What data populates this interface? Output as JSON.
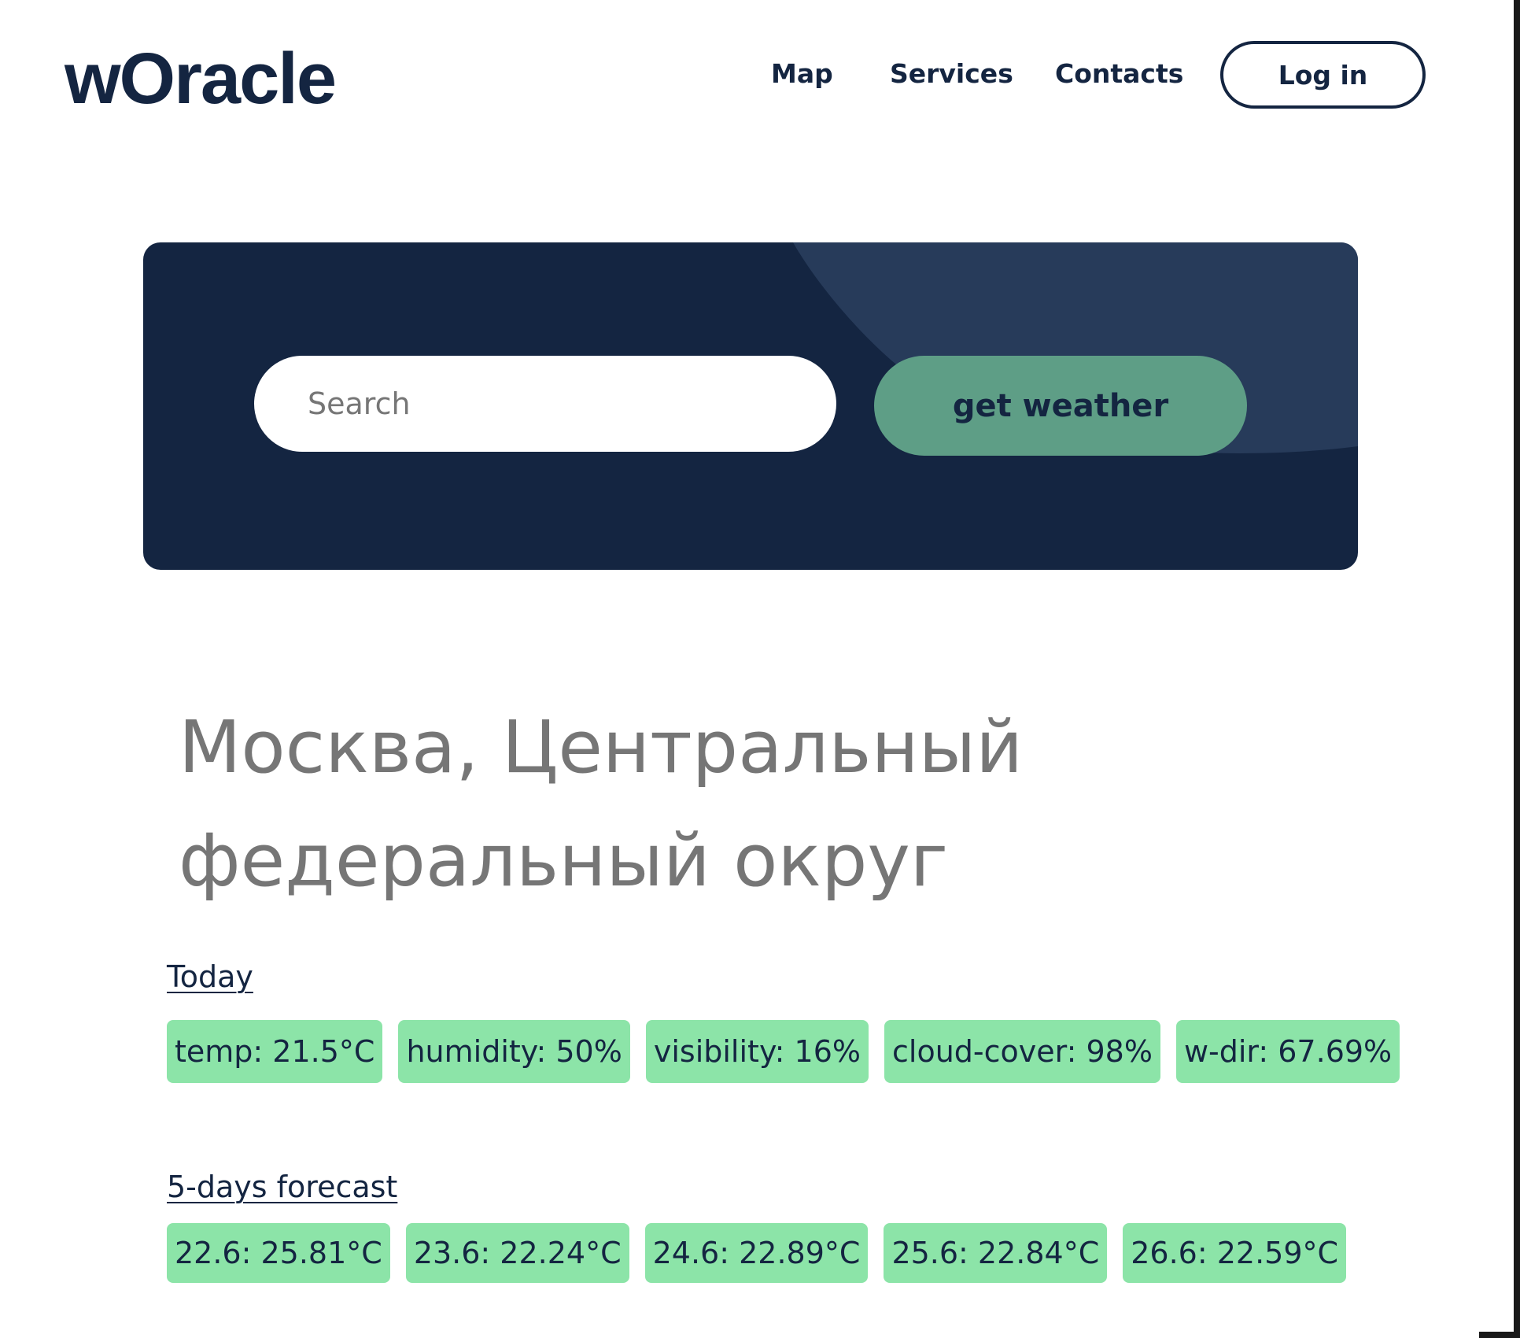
{
  "header": {
    "logo": "wOracle",
    "nav": {
      "map": "Map",
      "services": "Services",
      "contacts": "Contacts"
    },
    "login_label": "Log in"
  },
  "hero": {
    "search_placeholder": "Search",
    "search_value": "",
    "get_weather_label": "get weather"
  },
  "location": {
    "title": "Москва, Центральный федеральный округ"
  },
  "today": {
    "heading": "Today",
    "metrics": [
      "temp: 21.5°C",
      "humidity: 50%",
      "visibility: 16%",
      "cloud-cover: 98%",
      "w-dir: 67.69%"
    ]
  },
  "forecast": {
    "heading": "5-days forecast",
    "days": [
      "22.6: 25.81°C",
      "23.6: 22.24°C",
      "24.6: 22.89°C",
      "25.6: 22.84°C",
      "26.6: 22.59°C"
    ]
  },
  "colors": {
    "navy": "#142541",
    "swoosh": "#273b5a",
    "button_green": "#5e9e86",
    "chip_green": "#8ce4a8",
    "title_gray": "#767676"
  }
}
